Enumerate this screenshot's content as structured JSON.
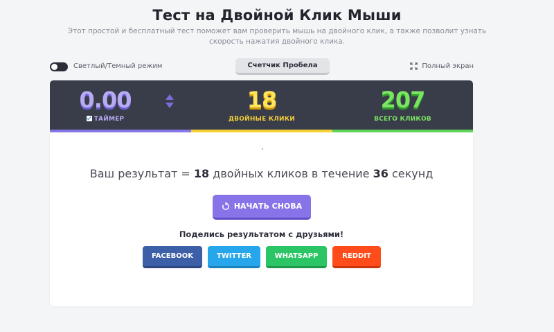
{
  "header": {
    "title": "Тест на Двойной Клик Мыши",
    "subtitle": "Этот простой и бесплатный тест поможет вам проверить мышь на двойного клик, а также позволит узнать скорость нажатия двойного клика."
  },
  "toolbar": {
    "theme_label": "Светлый/Темный режим",
    "space_counter_label": "Счетчик Пробела",
    "fullscreen_label": "Полный экран"
  },
  "scoreboard": {
    "timer": {
      "value": "0.00",
      "label": "ТАЙМЕР",
      "checked": true
    },
    "double_clicks": {
      "value": "18",
      "label": "ДВОЙНЫЕ КЛИКИ"
    },
    "total_clicks": {
      "value": "207",
      "label": "ВСЕГО КЛИКОВ"
    }
  },
  "result": {
    "prefix": "Ваш результат = ",
    "double_clicks": "18",
    "middle": " двойных кликов в течение ",
    "seconds": "36",
    "suffix": " секунд"
  },
  "restart_label": "НАЧАТЬ СНОВА",
  "share": {
    "label": "Поделись результатом с друзьями!",
    "facebook": "FACEBOOK",
    "twitter": "TWITTER",
    "whatsapp": "WHATSAPP",
    "reddit": "REDDIT"
  },
  "colors": {
    "timer": "#8677e8",
    "double_clicks": "#f5cf34",
    "total_clicks": "#5dd45a",
    "restart": "#8874e8",
    "facebook": "#3d5fa8",
    "twitter": "#28a6ec",
    "whatsapp": "#2cc565",
    "reddit": "#ff4c1a"
  },
  "icons": {
    "theme": "toggle-switch",
    "fullscreen": "expand-icon",
    "timer_adjust": "up-down-arrows-icon",
    "restart": "refresh-icon"
  }
}
